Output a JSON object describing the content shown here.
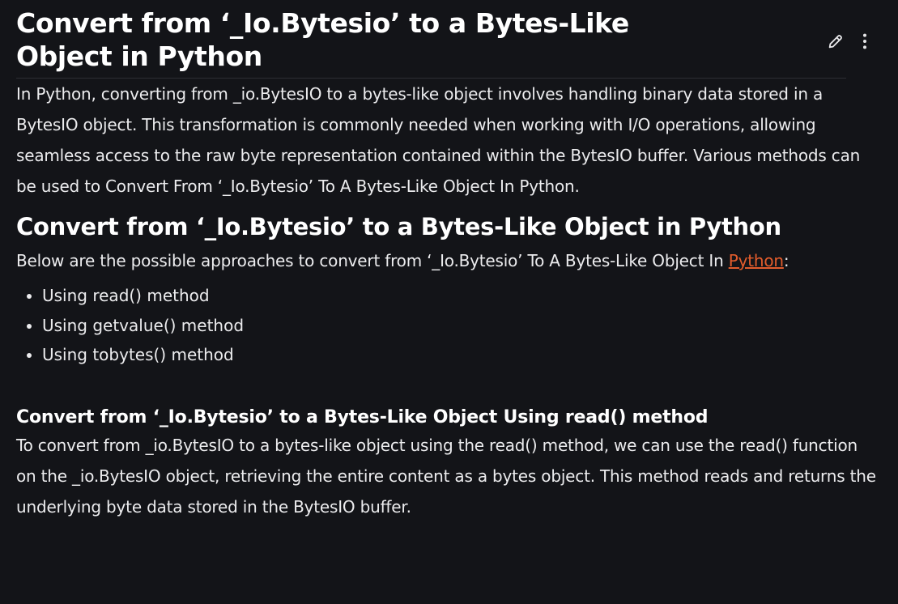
{
  "article": {
    "title": "Convert from ‘_Io.Bytesio’ to a Bytes-Like Object in Python",
    "intro": "In Python, converting from _io.BytesIO to a bytes-like object involves handling binary data stored in a BytesIO object. This transformation is commonly needed when working with I/O operations, allowing seamless access to the raw byte representation contained within the BytesIO buffer. Various methods can be used to Convert From ‘_Io.Bytesio’ To A Bytes-Like Object In Python.",
    "section_title": "Convert from ‘_Io.Bytesio’ to a Bytes-Like Object in Python",
    "approaches_text": "Below are the possible approaches to convert from ‘_Io.Bytesio’ To A Bytes-Like Object In ",
    "approaches_link": "Python",
    "approaches_suffix": ":",
    "approaches": [
      "Using read() method",
      "Using getvalue() method",
      "Using tobytes() method"
    ],
    "subsection_title": "Convert from ‘_Io.Bytesio’ to a Bytes-Like Object Using read() method",
    "read_text": "To convert from _io.BytesIO to a bytes-like object using the read() method, we can use the read() function on the _io.BytesIO object, retrieving the entire content as a bytes object. This method reads and returns the underlying byte data stored in the BytesIO buffer."
  },
  "icons": {
    "edit": "pencil-icon",
    "more": "more-vertical-icon"
  },
  "colors": {
    "background": "#131418",
    "text": "#ececee",
    "link": "#e25c2c"
  }
}
